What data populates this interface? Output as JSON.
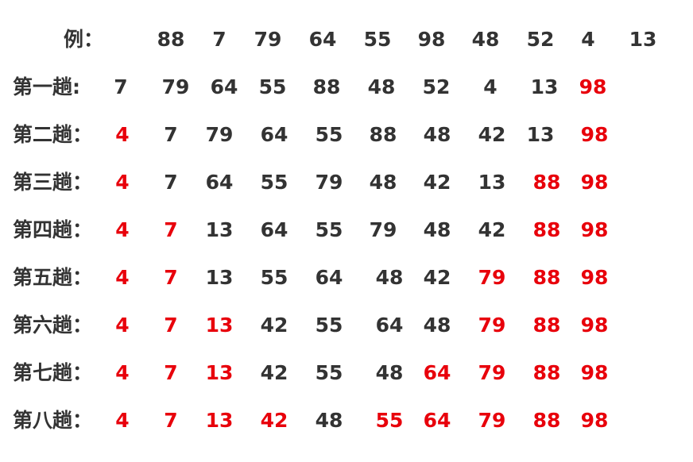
{
  "accent_color": "#e8000b",
  "text_color": "#333333",
  "rows": [
    {
      "label": "例：",
      "values": [
        "88",
        "7",
        "79",
        "64",
        "55",
        "98",
        "48",
        "52",
        "4",
        "13"
      ],
      "sorted": []
    },
    {
      "label": "第一趟:",
      "values": [
        "7",
        "79",
        "64",
        "55",
        "88",
        "48",
        "52",
        "4",
        "13",
        "98"
      ],
      "sorted": [
        9
      ]
    },
    {
      "label": "第二趟：",
      "values": [
        "4",
        "7",
        "79",
        "64",
        "55",
        "88",
        "48",
        "42",
        "13",
        "98"
      ],
      "sorted": [
        0,
        9
      ]
    },
    {
      "label": "第三趟：",
      "values": [
        "4",
        "7",
        "64",
        "55",
        "79",
        "48",
        "42",
        "13",
        "88",
        "98"
      ],
      "sorted": [
        0,
        8,
        9
      ]
    },
    {
      "label": "第四趟：",
      "values": [
        "4",
        "7",
        "13",
        "64",
        "55",
        "79",
        "48",
        "42",
        "88",
        "98"
      ],
      "sorted": [
        0,
        1,
        8,
        9
      ]
    },
    {
      "label": "第五趟：",
      "values": [
        "4",
        "7",
        "13",
        "55",
        "64",
        "48",
        "42",
        "79",
        "88",
        "98"
      ],
      "sorted": [
        0,
        1,
        7,
        8,
        9
      ]
    },
    {
      "label": "第六趟：",
      "values": [
        "4",
        "7",
        "13",
        "42",
        "55",
        "64",
        "48",
        "79",
        "88",
        "98"
      ],
      "sorted": [
        0,
        1,
        2,
        7,
        8,
        9
      ]
    },
    {
      "label": "第七趟：",
      "values": [
        "4",
        "7",
        "13",
        "42",
        "55",
        "48",
        "64",
        "79",
        "88",
        "98"
      ],
      "sorted": [
        0,
        1,
        2,
        6,
        7,
        8,
        9
      ]
    },
    {
      "label": "第八趟：",
      "values": [
        "4",
        "7",
        "13",
        "42",
        "48",
        "55",
        "64",
        "79",
        "88",
        "98"
      ],
      "sorted": [
        0,
        1,
        2,
        3,
        5,
        6,
        7,
        8,
        9
      ]
    }
  ]
}
